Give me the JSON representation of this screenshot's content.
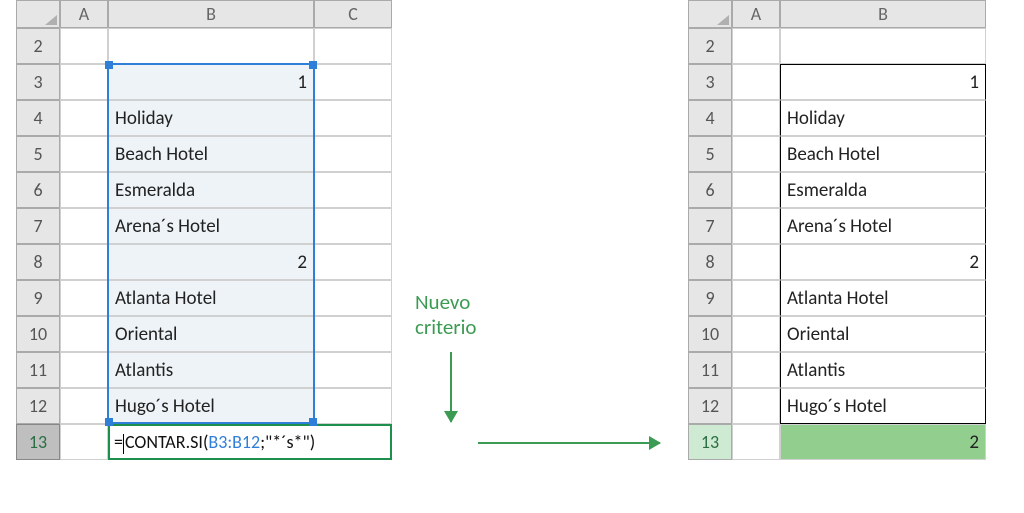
{
  "left": {
    "columns": [
      "A",
      "B",
      "C"
    ],
    "startRow": 2,
    "rows": [
      2,
      3,
      4,
      5,
      6,
      7,
      8,
      9,
      10,
      11,
      12,
      13
    ],
    "values": {
      "B3": "1",
      "B4": "Holiday",
      "B5": "Beach Hotel",
      "B6": "Esmeralda",
      "B7": "Arena´s Hotel",
      "B8": "2",
      "B9": "Atlanta Hotel",
      "B10": "Oriental",
      "B11": "Atlantis",
      "B12": "Hugo´s Hotel"
    },
    "formula": {
      "eq": "=",
      "func": "CONTAR.SI",
      "open": "(",
      "ref": "B3:B12",
      "sep": ";",
      "lit": "\"*´s*\"",
      "close": ")"
    }
  },
  "right": {
    "columns": [
      "A",
      "B"
    ],
    "rows": [
      2,
      3,
      4,
      5,
      6,
      7,
      8,
      9,
      10,
      11,
      12,
      13
    ],
    "values": {
      "B3": "1",
      "B4": "Holiday",
      "B5": "Beach Hotel",
      "B6": "Esmeralda",
      "B7": "Arena´s Hotel",
      "B8": "2",
      "B9": "Atlanta Hotel",
      "B10": "Oriental",
      "B11": "Atlantis",
      "B12": "Hugo´s Hotel",
      "B13": "2"
    }
  },
  "annotation": {
    "line1": "Nuevo",
    "line2": "criterio"
  }
}
